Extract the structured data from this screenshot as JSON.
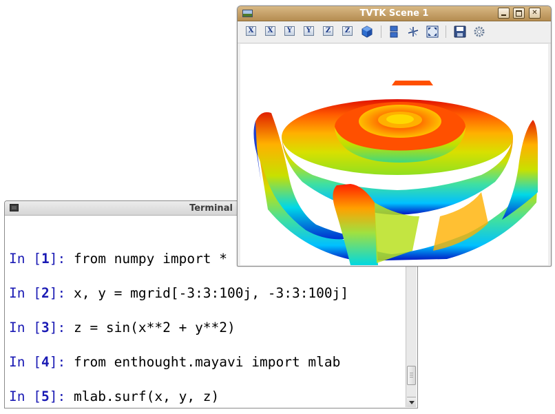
{
  "terminal": {
    "title": "Terminal",
    "lines": [
      {
        "prompt": "In",
        "number": "1",
        "code": "from numpy import *"
      },
      {
        "prompt": "In",
        "number": "2",
        "code": "x, y = mgrid[-3:3:100j, -3:3:100j]"
      },
      {
        "prompt": "In",
        "number": "3",
        "code": "z = sin(x**2 + y**2)"
      },
      {
        "prompt": "In",
        "number": "4",
        "code": "from enthought.mayavi import mlab"
      },
      {
        "prompt": "In",
        "number": "5",
        "code": "mlab.surf(x, y, z)"
      }
    ],
    "prompt_color": "#1a1ab4"
  },
  "scene": {
    "title": "TVTK Scene 1",
    "window_buttons": [
      "minimize",
      "maximize",
      "close"
    ],
    "toolbar": [
      {
        "icon": "view-x-plus-icon",
        "glyph": "X"
      },
      {
        "icon": "view-x-minus-icon",
        "glyph": "X"
      },
      {
        "icon": "view-y-plus-icon",
        "glyph": "Y"
      },
      {
        "icon": "view-y-minus-icon",
        "glyph": "Y"
      },
      {
        "icon": "view-z-plus-icon",
        "glyph": "Z"
      },
      {
        "icon": "view-z-minus-icon",
        "glyph": "Z"
      },
      {
        "icon": "isometric-view-icon",
        "glyph": ""
      },
      {
        "icon": "parallel-projection-icon",
        "glyph": ""
      },
      {
        "icon": "axes-indicator-icon",
        "glyph": ""
      },
      {
        "icon": "fullscreen-icon",
        "glyph": ""
      },
      {
        "icon": "save-icon",
        "glyph": ""
      },
      {
        "icon": "configure-icon",
        "glyph": ""
      }
    ],
    "plot": "mlab.surf(x, y, z) surface coloured by height with the jet colormap",
    "colormap": [
      "#0000d0",
      "#00c8ff",
      "#30e0a0",
      "#c8e000",
      "#ffd000",
      "#ff7000",
      "#e01000"
    ]
  }
}
